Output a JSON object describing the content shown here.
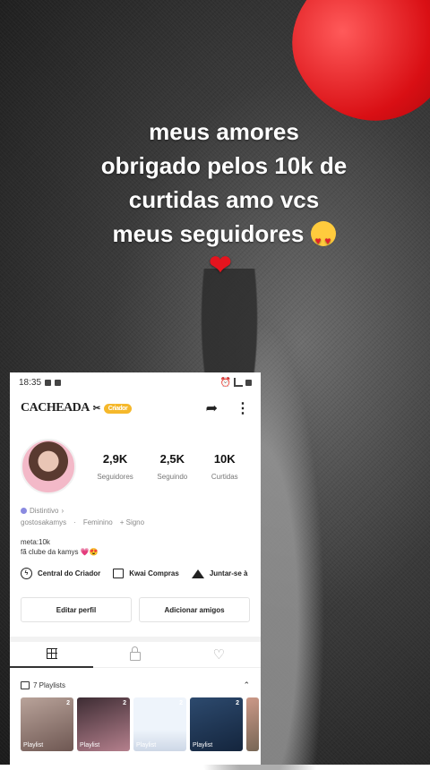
{
  "caption": {
    "lines": [
      "meus amores",
      "obrigado pelos 10k de",
      "curtidas amo vcs",
      "meus seguidores"
    ]
  },
  "status_bar": {
    "time": "18:35"
  },
  "profile": {
    "username": "CACHEADA",
    "badge": "Criador",
    "stats": [
      {
        "value": "2,9K",
        "label": "Seguidores"
      },
      {
        "value": "2,5K",
        "label": "Seguindo"
      },
      {
        "value": "10K",
        "label": "Curtidas"
      }
    ],
    "distintivo": "Distintivo",
    "handle": "gostosakamys",
    "gender": "Feminino",
    "signo": "+ Signo",
    "bio_line1": "meta:10k",
    "bio_line2": "fã clube da kamys"
  },
  "shortcuts": [
    "Central do Criador",
    "Kwai Compras",
    "Juntar-se à"
  ],
  "buttons": {
    "edit": "Editar perfil",
    "add": "Adicionar amigos"
  },
  "playlists": {
    "title": "7 Playlists",
    "items": [
      {
        "count": "2",
        "label": "Playlist"
      },
      {
        "count": "2",
        "label": "Playlist"
      },
      {
        "count": "2",
        "label": "Playlist"
      },
      {
        "count": "2",
        "label": "Playlist"
      }
    ]
  },
  "colors": {
    "balloon": "#d90f14",
    "badge": "#f5b82b"
  }
}
